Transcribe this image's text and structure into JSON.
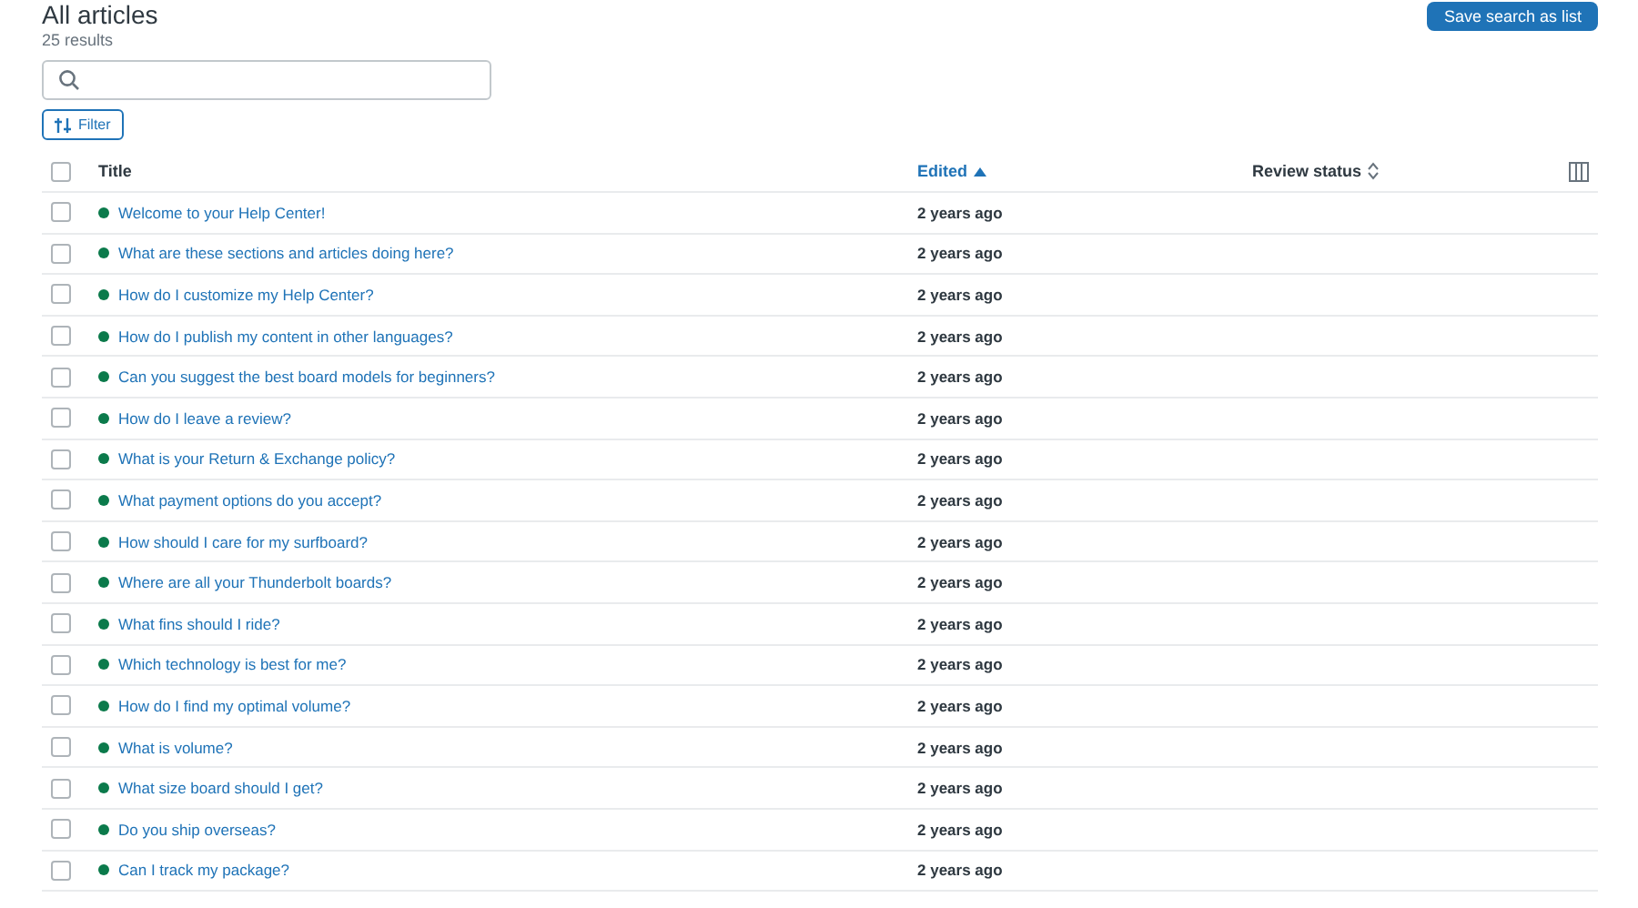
{
  "header": {
    "title": "All articles",
    "result_count": "25 results",
    "save_button": "Save search as list"
  },
  "filter_button": "Filter",
  "table": {
    "columns": [
      {
        "label": "Title",
        "sorted": false,
        "sortable": false
      },
      {
        "label": "Edited",
        "sorted": true,
        "sortable": true
      },
      {
        "label": "Review status",
        "sorted": false,
        "sortable": true
      }
    ],
    "select_all": {
      "checked": false
    },
    "rows": [
      {
        "title": "Welcome to your Help Center!",
        "edited": "2 years ago",
        "checked": false,
        "color": "#0b7a4b"
      },
      {
        "title": "What are these sections and articles doing here?",
        "edited": "2 years ago",
        "checked": false,
        "color": "#0b7a4b"
      },
      {
        "title": "How do I customize my Help Center?",
        "edited": "2 years ago",
        "checked": false,
        "color": "#0b7a4b"
      },
      {
        "title": "How do I publish my content in other languages?",
        "edited": "2 years ago",
        "checked": false,
        "color": "#0b7a4b"
      },
      {
        "title": "Can you suggest the best board models for beginners?",
        "edited": "2 years ago",
        "checked": false,
        "color": "#0b7a4b"
      },
      {
        "title": "How do I leave a review?",
        "edited": "2 years ago",
        "checked": false,
        "color": "#0b7a4b"
      },
      {
        "title": "What is your Return & Exchange policy?",
        "edited": "2 years ago",
        "checked": false,
        "color": "#0b7a4b"
      },
      {
        "title": "What payment options do you accept?",
        "edited": "2 years ago",
        "checked": false,
        "color": "#0b7a4b"
      },
      {
        "title": "How should I care for my surfboard?",
        "edited": "2 years ago",
        "checked": false,
        "color": "#0b7a4b"
      },
      {
        "title": "Where are all your Thunderbolt boards?",
        "edited": "2 years ago",
        "checked": false,
        "color": "#0b7a4b"
      },
      {
        "title": "What fins should I ride?",
        "edited": "2 years ago",
        "checked": false,
        "color": "#0b7a4b"
      },
      {
        "title": "Which technology is best for me?",
        "edited": "2 years ago",
        "checked": false,
        "color": "#0b7a4b"
      },
      {
        "title": "How do I find my optimal volume?",
        "edited": "2 years ago",
        "checked": false,
        "color": "#0b7a4b"
      },
      {
        "title": "What is volume?",
        "edited": "2 years ago",
        "checked": false,
        "color": "#0b7a4b"
      },
      {
        "title": "What size board should I get?",
        "edited": "2 years ago",
        "checked": false,
        "color": "#0b7a4b"
      },
      {
        "title": "Do you ship overseas?",
        "edited": "2 years ago",
        "checked": false,
        "color": "#0b7a4b"
      },
      {
        "title": "Can I track my package?",
        "edited": "2 years ago",
        "checked": false,
        "color": "#0b7a4b"
      }
    ]
  }
}
